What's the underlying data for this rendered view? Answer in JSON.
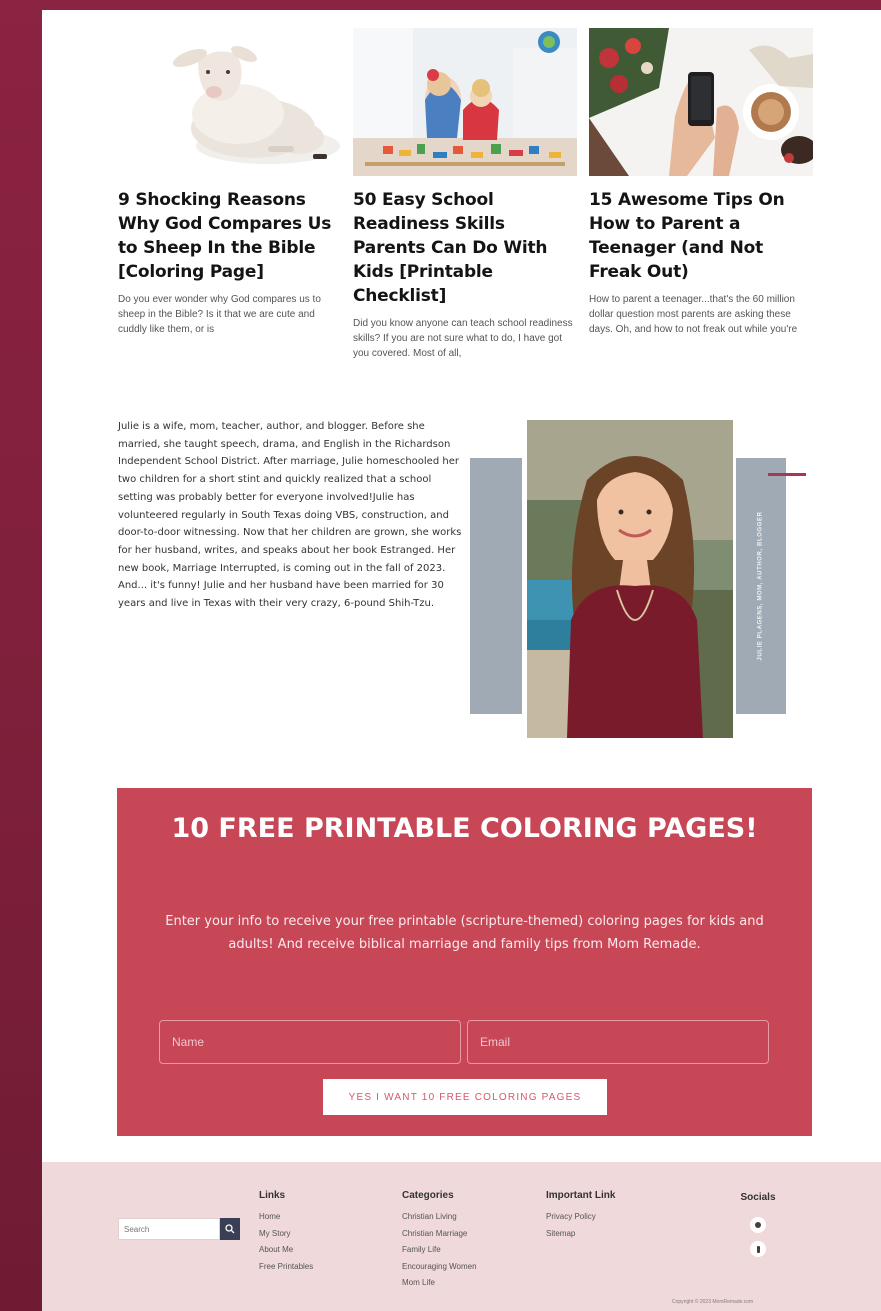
{
  "posts": [
    {
      "title": "9 Shocking Reasons Why God Compares Us to Sheep In the Bible [Coloring Page]",
      "excerpt": "Do you ever wonder why God compares us to sheep in the Bible? Is it that we are cute and cuddly like them, or is"
    },
    {
      "title": "50 Easy School Readiness Skills Parents Can Do With Kids [Printable Checklist]",
      "excerpt": "Did you know anyone can teach school readiness skills? If you are not sure what to do, I have got you covered. Most of all,"
    },
    {
      "title": "15 Awesome Tips On How to Parent a Teenager (and Not Freak Out)",
      "excerpt": "How to parent a teenager...that's the 60 million dollar question most parents are asking these days. Oh, and how to not freak out while you're"
    }
  ],
  "about": {
    "text": "Julie is a wife, mom, teacher, author, and blogger. Before she married, she taught speech, drama, and English in the Richardson Independent School District. After marriage, Julie homeschooled her two children for a short stint and quickly realized that a school setting was probably better for everyone involved!Julie has volunteered regularly in South Texas doing VBS, construction, and door-to-door witnessing. Now that her children are grown, she works for her husband, writes, and speaks about her book Estranged. Her new book, Marriage Interrupted, is coming out in the fall of 2023. And... it's funny! Julie and her husband have been married for 30 years and live in Texas with their very crazy, 6-pound Shih-Tzu.",
    "side_label": "JULIE PLAGENS, MOM, AUTHOR, BLOGGER"
  },
  "cta": {
    "title": "10 FREE PRINTABLE COLORING PAGES!",
    "subtitle": "Enter your info to receive your free printable (scripture-themed) coloring pages for kids and adults! And receive biblical marriage and family tips from Mom Remade.",
    "name_placeholder": "Name",
    "email_placeholder": "Email",
    "button_label": "YES I WANT 10 FREE COLORING PAGES"
  },
  "footer": {
    "search_placeholder": "Search",
    "links": {
      "heading": "Links",
      "items": [
        "Home",
        "My Story",
        "About Me",
        "Free Printables"
      ]
    },
    "categories": {
      "heading": "Categories",
      "items": [
        "Christian Living",
        "Christian Marriage",
        "Family Life",
        "Encouraging Women",
        "Mom Life"
      ]
    },
    "important": {
      "heading": "Important Link",
      "items": [
        "Privacy Policy",
        "Sitemap"
      ]
    },
    "socials": {
      "heading": "Socials",
      "icons": [
        "pinterest-icon",
        "facebook-icon"
      ]
    },
    "copyright": "Copyright © 2023 MomRemade.com"
  }
}
